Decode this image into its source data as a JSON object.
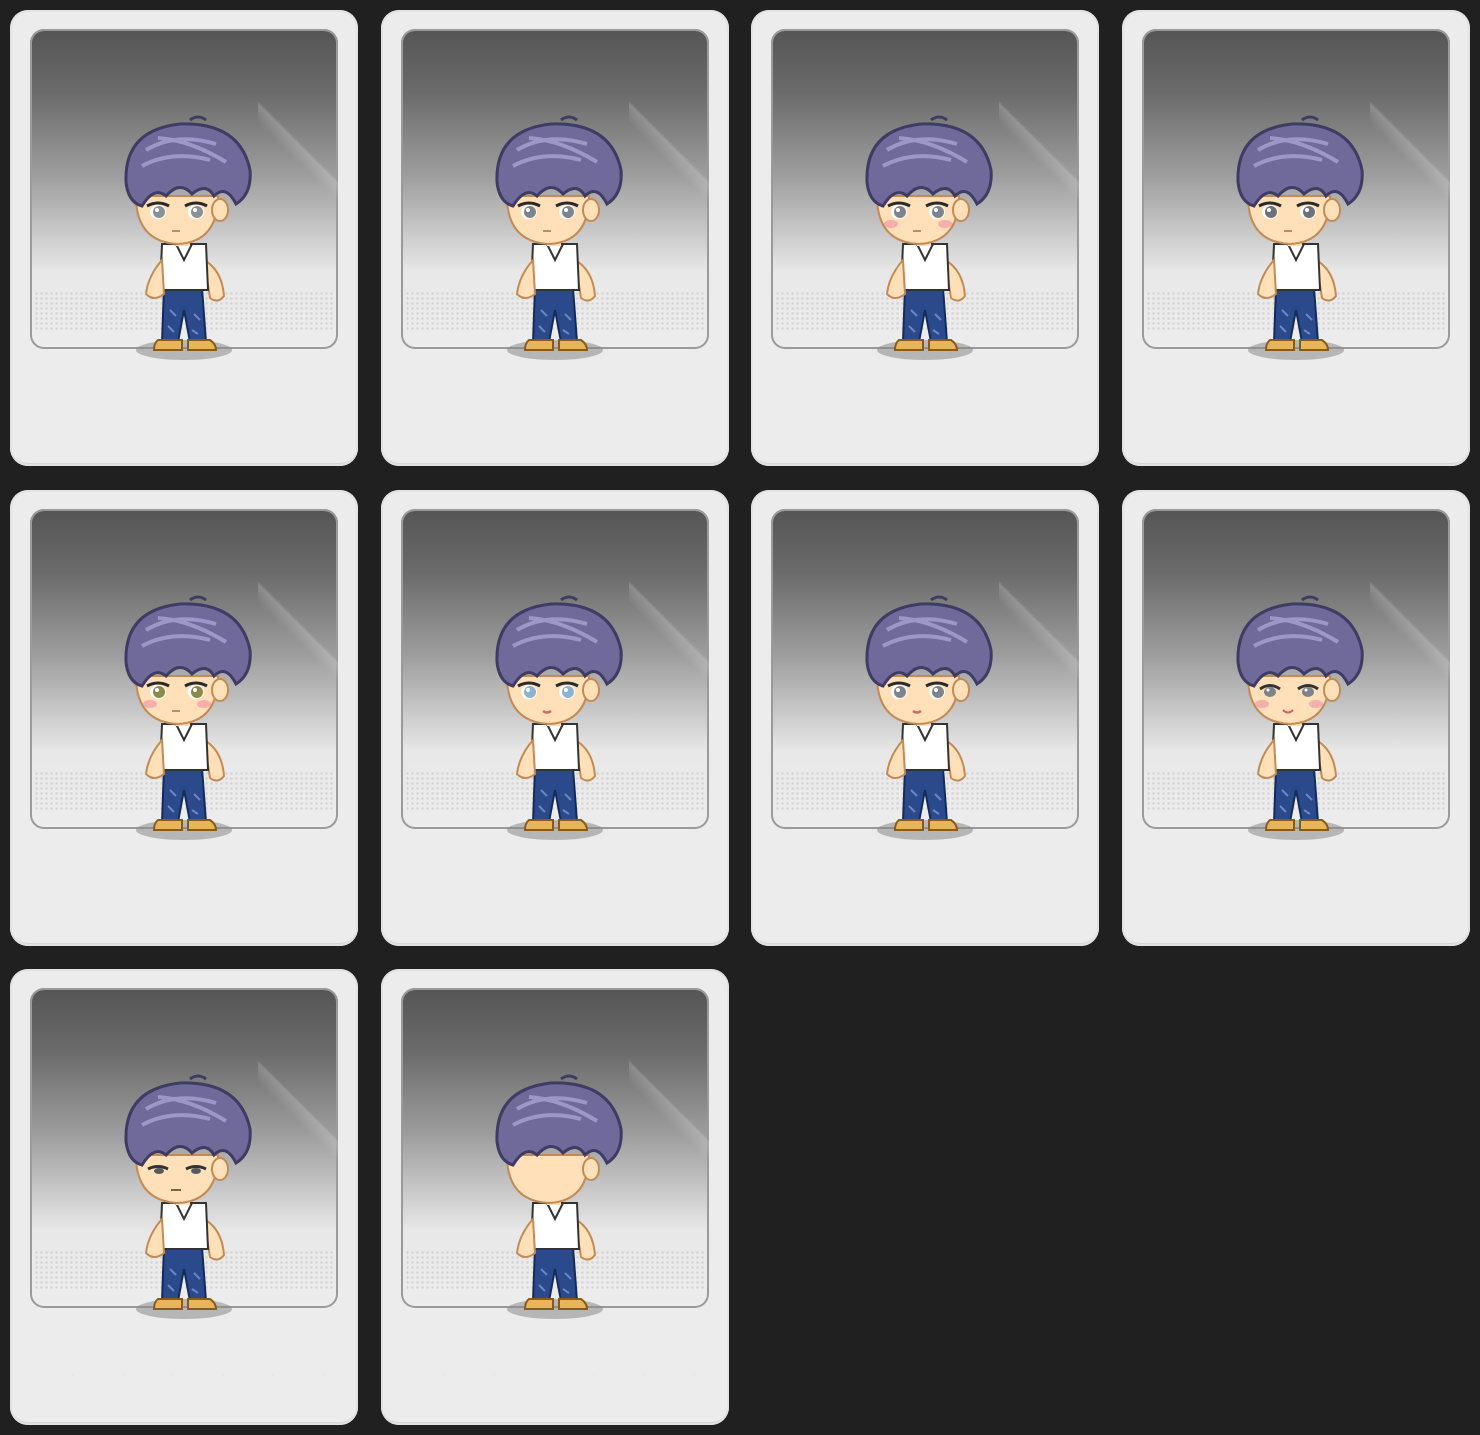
{
  "screen": {
    "title": "",
    "background": "#202020"
  },
  "palette": {
    "hair": "#6f6a99",
    "hair_highlight": "#a9a3d1",
    "hair_dark": "#3f3c63",
    "skin": "#ffe0b8",
    "shirt": "#ffffff",
    "pants": "#2b4a8c",
    "shoes": "#e8b55c",
    "card": "#ececec"
  },
  "cards": [
    {
      "name": "face-option-1",
      "face": "neutral-grey-eyes",
      "blush": false,
      "eye_color": "#8a9097",
      "mouth": "small"
    },
    {
      "name": "face-option-2",
      "face": "sleepy-eyes",
      "blush": false,
      "eye_color": "#7d848d",
      "mouth": "small"
    },
    {
      "name": "face-option-3",
      "face": "tired-eyes",
      "blush": true,
      "eye_color": "#7d848d",
      "mouth": "small"
    },
    {
      "name": "face-option-4",
      "face": "sharp-eyes",
      "blush": false,
      "eye_color": "#6d7279",
      "mouth": "small"
    },
    {
      "name": "face-option-5",
      "face": "round-yellow-eyes",
      "blush": true,
      "eye_color": "#8a8a4a",
      "mouth": "small"
    },
    {
      "name": "face-option-6",
      "face": "blue-eyes",
      "blush": false,
      "eye_color": "#8fb3cf",
      "mouth": "lip"
    },
    {
      "name": "face-option-7",
      "face": "lashed-eyes",
      "blush": false,
      "eye_color": "#7d848d",
      "mouth": "lip"
    },
    {
      "name": "face-option-8",
      "face": "smiling-eyes",
      "blush": true,
      "eye_color": "#7d848d",
      "mouth": "smile"
    },
    {
      "name": "face-option-9",
      "face": "narrow-eyes",
      "blush": false,
      "eye_color": "#555a60",
      "mouth": "flat"
    },
    {
      "name": "face-option-10",
      "face": "hidden-eyes",
      "blush": false,
      "eye_color": "#7d848d",
      "mouth": "none"
    }
  ]
}
